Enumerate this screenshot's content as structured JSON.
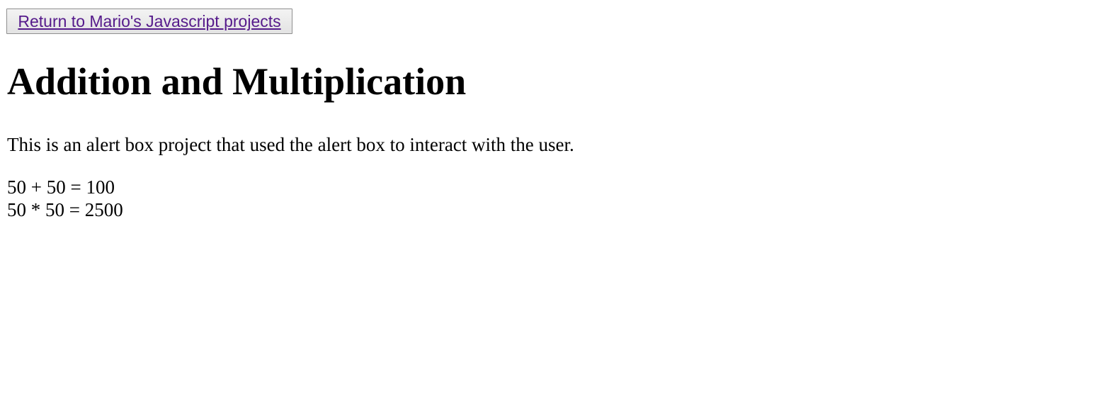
{
  "nav": {
    "return_label": "Return to Mario's Javascript projects"
  },
  "page": {
    "title": "Addition and Multiplication",
    "intro": "This is an alert box project that used the alert box to interact with the user."
  },
  "results": {
    "addition": "50 + 50 = 100",
    "multiplication": "50 * 50 = 2500"
  },
  "colors": {
    "link_visited": "#551a8b",
    "button_border": "#8f8f8f",
    "background": "#ffffff"
  }
}
